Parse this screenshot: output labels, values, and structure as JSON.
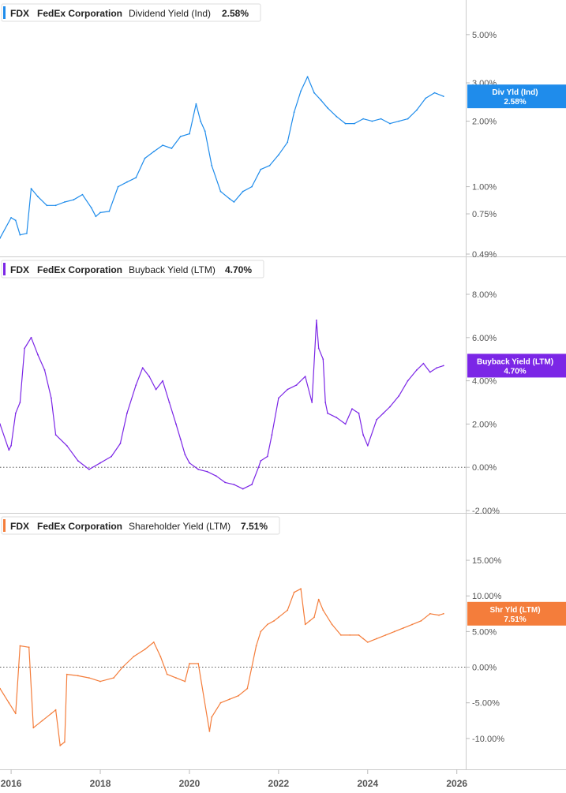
{
  "chart_data": [
    {
      "type": "line",
      "ticker": "FDX",
      "company": "FedEx Corporation",
      "metric": "Dividend Yield (Ind)",
      "current_value": "2.58%",
      "color": "#1f8ceb",
      "scale": "log",
      "ylim": [
        0.49,
        6.0
      ],
      "yticks": [
        {
          "value": 5.0,
          "label": "5.00%"
        },
        {
          "value": 3.0,
          "label": "3.00%"
        },
        {
          "value": 2.0,
          "label": "2.00%"
        },
        {
          "value": 1.0,
          "label": "1.00%"
        },
        {
          "value": 0.75,
          "label": "0.75%"
        },
        {
          "value": 0.49,
          "label": "0.49%"
        }
      ],
      "badge": {
        "label": "Div Yld (Ind)",
        "value": "2.58%"
      },
      "x": [
        2015.75,
        2016.0,
        2016.1,
        2016.2,
        2016.35,
        2016.45,
        2016.6,
        2016.8,
        2017.0,
        2017.2,
        2017.4,
        2017.6,
        2017.8,
        2017.9,
        2018.0,
        2018.2,
        2018.4,
        2018.6,
        2018.8,
        2019.0,
        2019.2,
        2019.4,
        2019.6,
        2019.8,
        2020.0,
        2020.15,
        2020.25,
        2020.35,
        2020.5,
        2020.7,
        2020.9,
        2021.0,
        2021.2,
        2021.4,
        2021.6,
        2021.8,
        2022.0,
        2022.2,
        2022.35,
        2022.5,
        2022.65,
        2022.8,
        2022.95,
        2023.1,
        2023.3,
        2023.5,
        2023.7,
        2023.9,
        2024.1,
        2024.3,
        2024.5,
        2024.7,
        2024.9,
        2025.1,
        2025.3,
        2025.5,
        2025.7
      ],
      "values": [
        0.58,
        0.72,
        0.7,
        0.6,
        0.61,
        0.98,
        0.9,
        0.82,
        0.82,
        0.85,
        0.87,
        0.92,
        0.8,
        0.73,
        0.76,
        0.77,
        1.0,
        1.05,
        1.1,
        1.35,
        1.45,
        1.55,
        1.5,
        1.7,
        1.75,
        2.4,
        2.0,
        1.8,
        1.25,
        0.95,
        0.88,
        0.85,
        0.95,
        1.0,
        1.2,
        1.25,
        1.4,
        1.6,
        2.2,
        2.75,
        3.2,
        2.7,
        2.5,
        2.3,
        2.1,
        1.95,
        1.95,
        2.05,
        2.0,
        2.05,
        1.95,
        2.0,
        2.05,
        2.25,
        2.55,
        2.7,
        2.6
      ]
    },
    {
      "type": "line",
      "ticker": "FDX",
      "company": "FedEx Corporation",
      "metric": "Buyback Yield (LTM)",
      "current_value": "4.70%",
      "color": "#7b26e6",
      "scale": "linear",
      "ylim": [
        -2.0,
        8.0
      ],
      "yticks": [
        {
          "value": 8.0,
          "label": "8.00%"
        },
        {
          "value": 6.0,
          "label": "6.00%"
        },
        {
          "value": 4.0,
          "label": "4.00%"
        },
        {
          "value": 2.0,
          "label": "2.00%"
        },
        {
          "value": 0.0,
          "label": "0.00%"
        },
        {
          "value": -2.0,
          "label": "-2.00%"
        }
      ],
      "zero_line": true,
      "badge": {
        "label": "Buyback Yield (LTM)",
        "value": "4.70%"
      },
      "x": [
        2015.75,
        2015.95,
        2016.0,
        2016.1,
        2016.2,
        2016.3,
        2016.45,
        2016.6,
        2016.75,
        2016.9,
        2017.0,
        2017.25,
        2017.5,
        2017.75,
        2018.0,
        2018.25,
        2018.45,
        2018.6,
        2018.8,
        2018.95,
        2019.1,
        2019.25,
        2019.4,
        2019.55,
        2019.7,
        2019.8,
        2019.9,
        2020.0,
        2020.2,
        2020.4,
        2020.6,
        2020.8,
        2021.0,
        2021.2,
        2021.4,
        2021.55,
        2021.6,
        2021.75,
        2021.85,
        2022.0,
        2022.2,
        2022.4,
        2022.6,
        2022.75,
        2022.85,
        2022.9,
        2023.0,
        2023.05,
        2023.1,
        2023.3,
        2023.5,
        2023.65,
        2023.8,
        2023.9,
        2024.0,
        2024.2,
        2024.35,
        2024.5,
        2024.7,
        2024.9,
        2025.1,
        2025.25,
        2025.4,
        2025.55,
        2025.7
      ],
      "values": [
        2.0,
        0.8,
        1.0,
        2.5,
        3.0,
        5.5,
        6.0,
        5.2,
        4.5,
        3.2,
        1.5,
        1.0,
        0.3,
        -0.1,
        0.2,
        0.5,
        1.1,
        2.5,
        3.8,
        4.6,
        4.2,
        3.6,
        4.0,
        3.0,
        2.0,
        1.3,
        0.6,
        0.2,
        -0.1,
        -0.2,
        -0.4,
        -0.7,
        -0.8,
        -1.0,
        -0.8,
        0.0,
        0.3,
        0.5,
        1.5,
        3.2,
        3.6,
        3.8,
        4.2,
        3.0,
        6.8,
        5.5,
        5.0,
        3.0,
        2.5,
        2.3,
        2.0,
        2.7,
        2.5,
        1.5,
        1.0,
        2.2,
        2.5,
        2.8,
        3.3,
        4.0,
        4.5,
        4.8,
        4.4,
        4.6,
        4.7
      ]
    },
    {
      "type": "line",
      "ticker": "FDX",
      "company": "FedEx Corporation",
      "metric": "Shareholder Yield (LTM)",
      "current_value": "7.51%",
      "color": "#f47d3b",
      "scale": "linear",
      "ylim": [
        -14.0,
        17.0
      ],
      "yticks": [
        {
          "value": 15.0,
          "label": "15.00%"
        },
        {
          "value": 10.0,
          "label": "10.00%"
        },
        {
          "value": 5.0,
          "label": "5.00%"
        },
        {
          "value": 0.0,
          "label": "0.00%"
        },
        {
          "value": -5.0,
          "label": "-5.00%"
        },
        {
          "value": -10.0,
          "label": "-10.00%"
        }
      ],
      "zero_line": true,
      "badge": {
        "label": "Shr Yld (LTM)",
        "value": "7.51%"
      },
      "x": [
        2015.75,
        2015.95,
        2016.1,
        2016.2,
        2016.4,
        2016.5,
        2016.7,
        2016.9,
        2017.0,
        2017.1,
        2017.2,
        2017.25,
        2017.5,
        2017.75,
        2018.0,
        2018.3,
        2018.5,
        2018.75,
        2019.0,
        2019.2,
        2019.35,
        2019.5,
        2019.7,
        2019.9,
        2020.0,
        2020.2,
        2020.45,
        2020.5,
        2020.7,
        2020.9,
        2021.1,
        2021.3,
        2021.5,
        2021.6,
        2021.75,
        2021.9,
        2022.0,
        2022.2,
        2022.35,
        2022.5,
        2022.6,
        2022.7,
        2022.8,
        2022.9,
        2023.0,
        2023.2,
        2023.4,
        2023.6,
        2023.8,
        2023.9,
        2024.0,
        2024.2,
        2024.4,
        2024.6,
        2024.8,
        2025.0,
        2025.2,
        2025.4,
        2025.6,
        2025.7
      ],
      "values": [
        -3.0,
        -5.0,
        -6.5,
        3.0,
        2.8,
        -8.5,
        -7.5,
        -6.5,
        -6.0,
        -11.0,
        -10.5,
        -1.0,
        -1.2,
        -1.5,
        -2.0,
        -1.5,
        0.0,
        1.5,
        2.5,
        3.5,
        1.5,
        -1.0,
        -1.5,
        -2.0,
        0.5,
        0.5,
        -9.0,
        -7.0,
        -5.0,
        -4.5,
        -4.0,
        -3.0,
        3.0,
        5.0,
        6.0,
        6.5,
        7.0,
        8.0,
        10.5,
        11.0,
        6.0,
        6.5,
        7.0,
        9.5,
        8.0,
        6.0,
        4.5,
        4.5,
        4.5,
        4.0,
        3.5,
        4.0,
        4.5,
        5.0,
        5.5,
        6.0,
        6.5,
        7.5,
        7.3,
        7.5
      ]
    }
  ],
  "x_axis": {
    "min": 2015.75,
    "max": 2026.2,
    "ticks": [
      {
        "value": 2016,
        "label": "2016"
      },
      {
        "value": 2018,
        "label": "2018"
      },
      {
        "value": 2020,
        "label": "2020"
      },
      {
        "value": 2022,
        "label": "2022"
      },
      {
        "value": 2024,
        "label": "2024"
      },
      {
        "value": 2026,
        "label": "2026"
      }
    ]
  }
}
